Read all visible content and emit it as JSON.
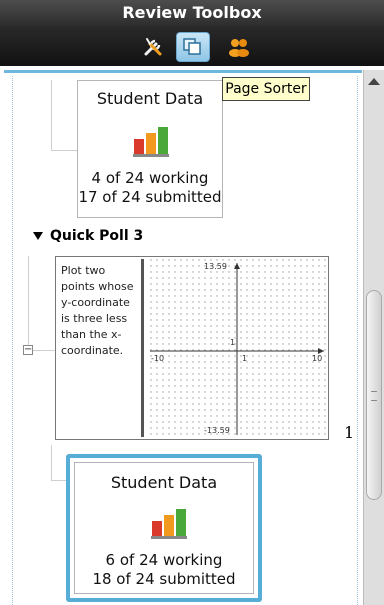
{
  "window": {
    "title": "Review Toolbox"
  },
  "tabs": [
    {
      "name": "tools",
      "icon": "wrench-screwdriver-icon"
    },
    {
      "name": "page-sorter",
      "icon": "page-sorter-icon",
      "selected": true
    },
    {
      "name": "class",
      "icon": "class-students-icon"
    }
  ],
  "tooltip": {
    "text": "Page Sorter"
  },
  "student_data_cards": [
    {
      "title": "Student Data",
      "working": "4 of 24 working",
      "submitted": "17 of 24 submitted"
    },
    {
      "title": "Student Data",
      "working": "6 of 24 working",
      "submitted": "18 of 24 submitted"
    }
  ],
  "quick_poll": {
    "label": "Quick Poll 3",
    "prompt": "Plot two points whose y-coordinate is three less than the x-coordinate.",
    "graph": {
      "y_max": "13.59",
      "y_min": "-13.59",
      "x_min": "-10",
      "x_max": "10",
      "x_tick": "1",
      "y_tick": "1"
    },
    "page_number": "1"
  },
  "colors": {
    "selection_border": "#56aed6",
    "bar_red": "#d93a2b",
    "bar_orange": "#f29a1f",
    "bar_green": "#4aa83a"
  }
}
